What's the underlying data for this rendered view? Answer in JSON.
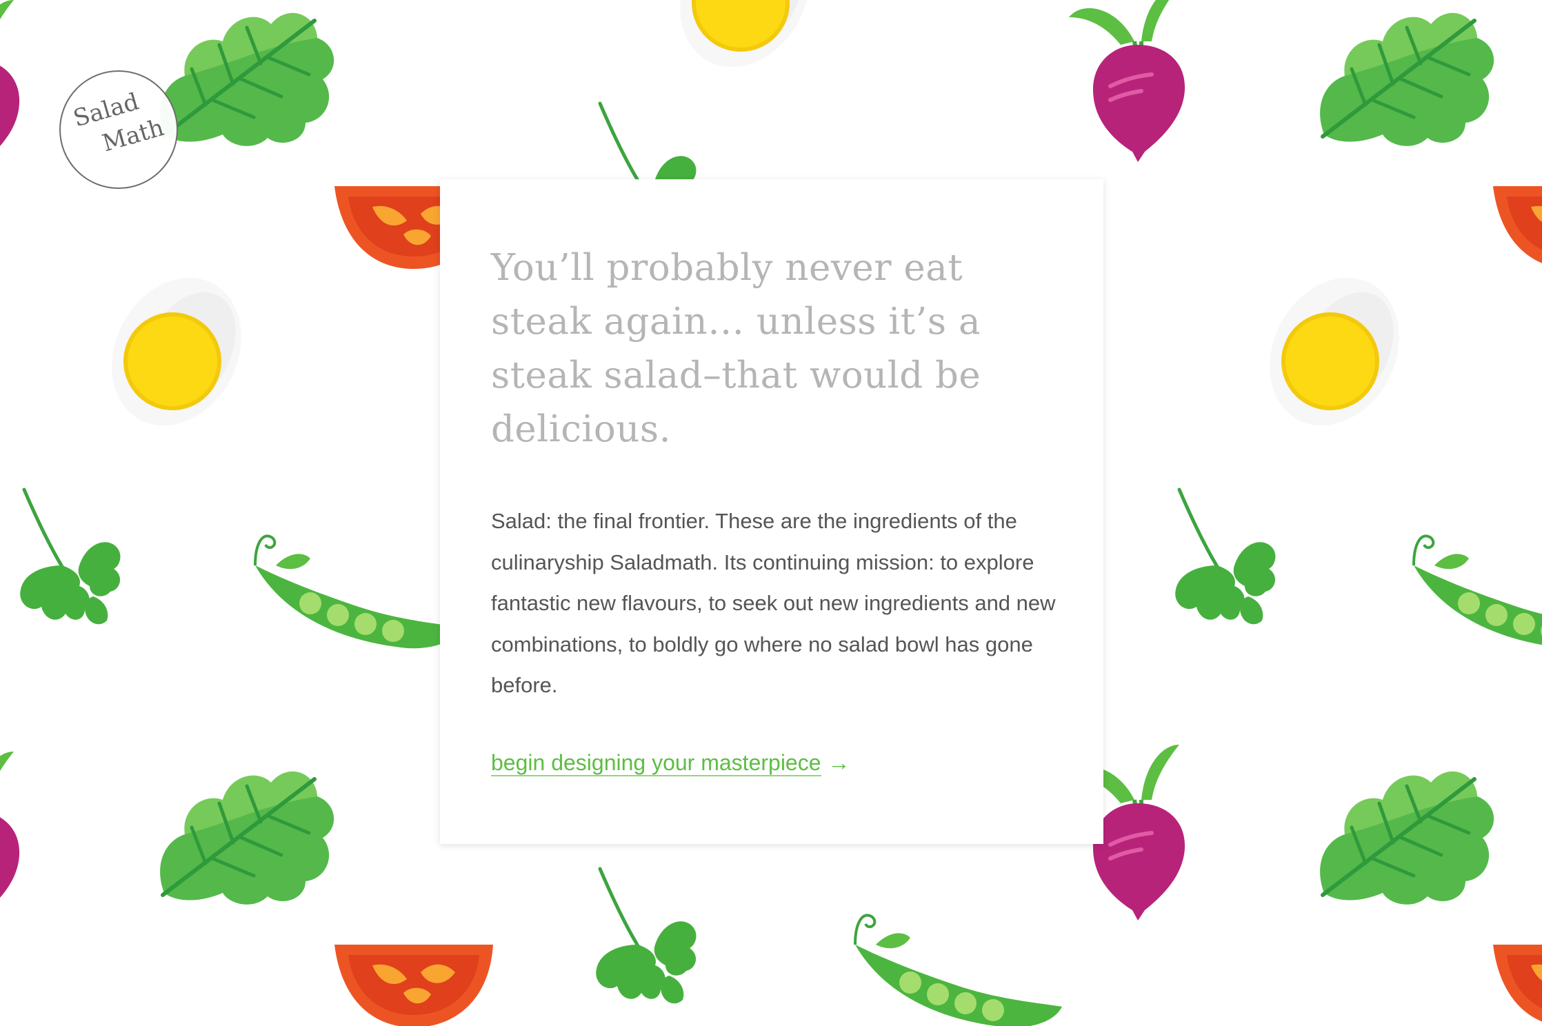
{
  "logo": {
    "line1": "Salad",
    "line2": "Math"
  },
  "card": {
    "headline": "You’ll probably never eat steak again… unless it’s a steak salad–that would be delicious.",
    "body": "Salad: the final frontier. These are the ingredients of the culinaryship Saladmath. Its continuing mission: to explore fantastic new flavours, to seek out new ingredients and new combinations, to boldly go where no salad bowl has gone before.",
    "cta_label": "begin designing your masterpiece",
    "cta_arrow": "→"
  },
  "background_pattern": {
    "icons": [
      "lettuce-leaf-icon",
      "egg-icon",
      "beet-icon",
      "tomato-slice-icon",
      "cilantro-icon",
      "pea-pod-icon"
    ]
  },
  "colors": {
    "headline": "#b5b5b5",
    "body": "#555555",
    "accent_green": "#5cbe42",
    "lettuce": "#54b94a",
    "beet": "#b8237a",
    "tomato": "#ed5424",
    "egg_yolk": "#fcd913"
  }
}
